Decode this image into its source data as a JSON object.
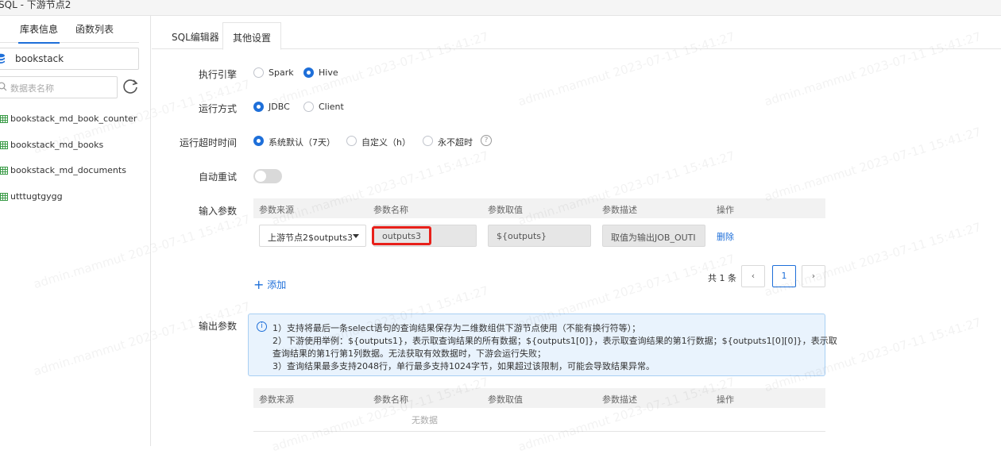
{
  "window": {
    "title": "SQL - 下游节点2"
  },
  "sidebar": {
    "tabs": [
      {
        "label": "库表信息"
      },
      {
        "label": "函数列表"
      }
    ],
    "database": "bookstack",
    "search_placeholder": "数据表名称",
    "tables": [
      {
        "label": "bookstack_md_book_counter"
      },
      {
        "label": "bookstack_md_books"
      },
      {
        "label": "bookstack_md_documents"
      },
      {
        "label": "utttugtgygg"
      }
    ]
  },
  "main": {
    "tabs": [
      {
        "label": "SQL编辑器"
      },
      {
        "label": "其他设置"
      }
    ],
    "engine": {
      "label": "执行引擎",
      "options": [
        "Spark",
        "Hive"
      ],
      "selected": "Hive"
    },
    "run_mode": {
      "label": "运行方式",
      "options": [
        "JDBC",
        "Client"
      ],
      "selected": "JDBC"
    },
    "timeout": {
      "label": "运行超时时间",
      "options": [
        "系统默认（7天）",
        "自定义（h）",
        "永不超时"
      ],
      "selected": "系统默认（7天）",
      "help": "?"
    },
    "auto_retry": {
      "label": "自动重试",
      "on": false
    },
    "input_params": {
      "label": "输入参数",
      "columns": [
        "参数来源",
        "参数名称",
        "参数取值",
        "参数描述",
        "操作"
      ],
      "row": {
        "source": "上游节点2$outputs3",
        "name": "outputs3",
        "value": "${outputs}",
        "desc": "取值为输出JOB_OUTI",
        "action": "删除"
      },
      "add_label": "添加",
      "total": "共 1 条",
      "page": "1",
      "prev": "‹",
      "next": "›"
    },
    "output_params": {
      "label": "输出参数",
      "info_lines": [
        "1）支持将最后一条select语句的查询结果保存为二维数组供下游节点使用（不能有换行符等）；",
        "2）下游使用举例：${outputs1}，表示取查询结果的所有数据；${outputs1[0]}，表示取查询结果的第1行数据；${outputs1[0][0]}，表示取",
        "查询结果的第1行第1列数据。无法获取有效数据时，下游会运行失败；",
        "3）查询结果最多支持2048行，单行最多支持1024字节，如果超过该限制，可能会导致结果异常。"
      ],
      "columns": [
        "参数来源",
        "参数名称",
        "参数取值",
        "参数描述",
        "操作"
      ],
      "empty_text": "无数据"
    }
  },
  "watermark": "admin.mammut 2023-07-11 15:41:27",
  "colors": {
    "accent": "#1e6fd9",
    "highlight": "#e8201a",
    "info_bg": "#e9f3fd"
  }
}
